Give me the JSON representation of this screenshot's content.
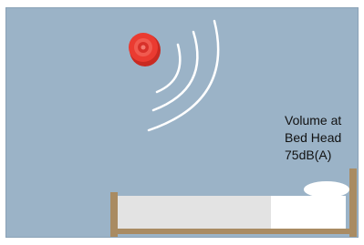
{
  "annotation": {
    "line1": "Volume at",
    "line2": "Bed Head",
    "line3": "75dB(A)"
  },
  "colors": {
    "wall": "#9bb3c7",
    "sounder": "#e8392f",
    "sound_waves": "#ffffff",
    "bed_frame": "#a98b62",
    "mattress": "#e3e3e3",
    "pillow": "#ffffff"
  },
  "icons": {
    "sounder": "alarm-sounder-icon",
    "waves": "sound-waves-icon",
    "bed": "bed-icon"
  }
}
